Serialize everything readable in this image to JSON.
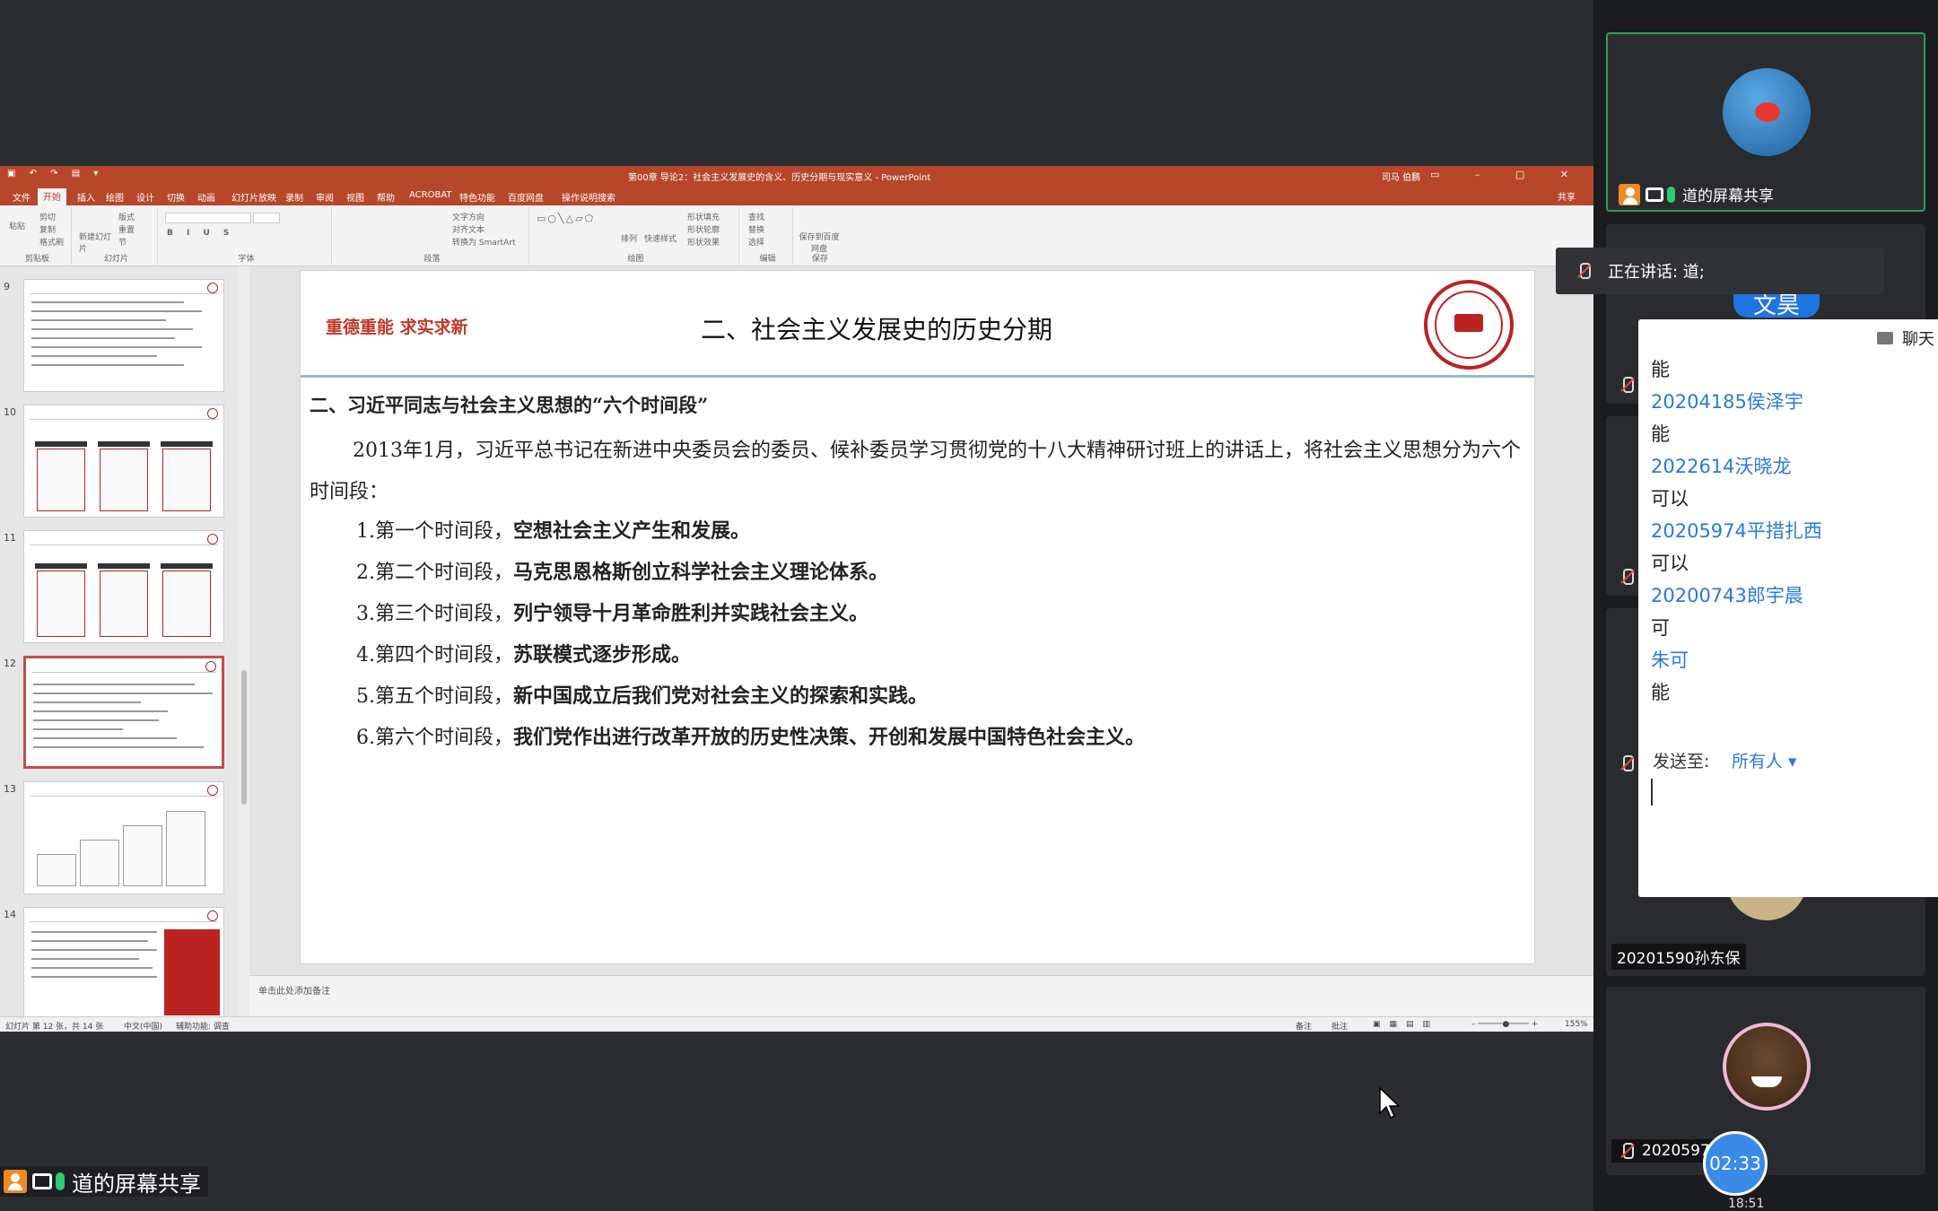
{
  "powerpoint": {
    "window_title": "第00章 导论2：社会主义发展史的含义、历史分期与现实意义 - PowerPoint",
    "user_name": "司马 伯鹏",
    "tabs": [
      "文件",
      "开始",
      "插入",
      "绘图",
      "设计",
      "切换",
      "动画",
      "幻灯片放映",
      "录制",
      "审阅",
      "视图",
      "帮助",
      "ACROBAT",
      "特色功能",
      "百度网盘",
      "操作说明搜索"
    ],
    "active_tab": "开始",
    "share_label": "共享",
    "ribbon_groups": [
      "剪贴板",
      "幻灯片",
      "字体",
      "段落",
      "绘图",
      "编辑",
      "保存"
    ],
    "ribbon_items": {
      "paste": "粘贴",
      "cut": "剪切",
      "copy": "复制",
      "format_painter": "格式刷",
      "new_slide": "新建幻灯片",
      "layout": "版式",
      "reset": "重置",
      "section": "节",
      "text_direction": "文字方向",
      "align_text": "对齐文本",
      "convert_smartart": "转换为 SmartArt",
      "arrange": "排列",
      "quick_styles": "快速样式",
      "shape_fill": "形状填充",
      "shape_outline": "形状轮廓",
      "shape_effects": "形状效果",
      "find": "查找",
      "replace": "替换",
      "select": "选择",
      "save_to_baidu": "保存到百度网盘"
    },
    "slide_numbers": [
      "9",
      "10",
      "11",
      "12",
      "13",
      "14"
    ],
    "selected_slide": "12",
    "slide": {
      "motto": "重德重能  求实求新",
      "title": "二、社会主义发展史的历史分期",
      "section_heading": "二、习近平同志与社会主义思想的“六个时间段”",
      "intro": "2013年1月，习近平总书记在新进中央委员会的委员、候补委员学习贯彻党的十八大精神研讨班上的讲话上，将社会主义思想分为六个时间段：",
      "periods": [
        {
          "label": "1.第一个时间段，",
          "text": "空想社会主义产生和发展。"
        },
        {
          "label": "2.第二个时间段，",
          "text": "马克思恩格斯创立科学社会主义理论体系。"
        },
        {
          "label": "3.第三个时间段，",
          "text": "列宁领导十月革命胜利并实践社会主义。"
        },
        {
          "label": "4.第四个时间段，",
          "text": "苏联模式逐步形成。"
        },
        {
          "label": "5.第五个时间段，",
          "text": "新中国成立后我们党对社会主义的探索和实践。"
        },
        {
          "label": "6.第六个时间段，",
          "text": "我们党作出进行改革开放的历史性决策、开创和发展中国特色社会主义。"
        }
      ]
    },
    "notes_placeholder": "单击此处添加备注",
    "status": {
      "slide_counter": "幻灯片 第 12 张，共 14 张",
      "language": "中文(中国)",
      "accessibility": "辅助功能: 调查",
      "notes": "备注",
      "comments": "批注",
      "zoom": "155%"
    }
  },
  "screen_share_indicator": "道的屏幕共享",
  "meeting": {
    "participants": [
      {
        "name": "道的屏幕共享"
      },
      {
        "name": "文昊"
      },
      {
        "name": "20201590孙东保"
      },
      {
        "name": "20205974"
      }
    ],
    "speaking_label": "正在讲话: 道;",
    "timer": "02:33",
    "clock": "18:51"
  },
  "chat": {
    "title": "聊天",
    "messages": [
      {
        "kind": "text",
        "value": "能"
      },
      {
        "kind": "sender",
        "value": "20204185侯泽宇"
      },
      {
        "kind": "text",
        "value": "能"
      },
      {
        "kind": "sender",
        "value": "2022614沃晓龙"
      },
      {
        "kind": "text",
        "value": "可以"
      },
      {
        "kind": "sender",
        "value": "20205974平措扎西"
      },
      {
        "kind": "text",
        "value": "可以"
      },
      {
        "kind": "sender",
        "value": "20200743郎宇晨"
      },
      {
        "kind": "text",
        "value": "可"
      },
      {
        "kind": "sender",
        "value": "朱可"
      },
      {
        "kind": "text",
        "value": "能"
      }
    ],
    "send_to_label": "发送至:",
    "send_to_value": "所有人 ▾"
  },
  "colors": {
    "ppt_accent": "#b7472a",
    "motto_red": "#c0392b",
    "active_border": "#2e9e59",
    "chat_sender": "#2a7ad6",
    "timer": "#3a8be8"
  }
}
